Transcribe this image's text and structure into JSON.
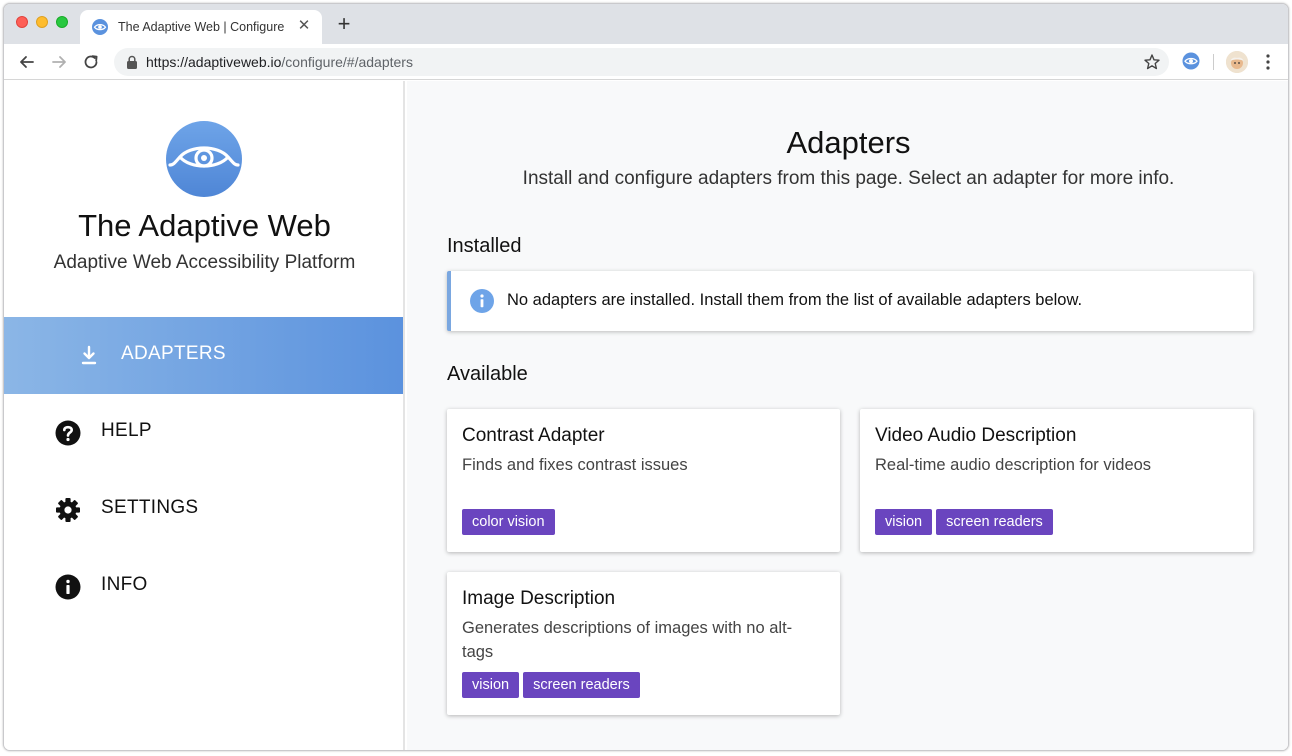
{
  "browser": {
    "tab_title": "The Adaptive Web | Configure",
    "tab_close": "✕",
    "new_tab": "+",
    "url_domain": "https://adaptiveweb.io",
    "url_path": "/configure/#/adapters"
  },
  "sidebar": {
    "brand_title": "The Adaptive Web",
    "brand_subtitle": "Adaptive Web Accessibility Platform",
    "items": [
      {
        "label": "ADAPTERS",
        "icon": "download-icon",
        "active": true
      },
      {
        "label": "HELP",
        "icon": "help-circle-icon",
        "active": false
      },
      {
        "label": "SETTINGS",
        "icon": "gear-icon",
        "active": false
      },
      {
        "label": "INFO",
        "icon": "info-circle-icon",
        "active": false
      }
    ]
  },
  "main": {
    "title": "Adapters",
    "subtitle": "Install and configure adapters from this page. Select an adapter for more info.",
    "installed_heading": "Installed",
    "installed_alert": "No adapters are installed. Install them from the list of available adapters below.",
    "available_heading": "Available",
    "adapters": [
      {
        "name": "Contrast Adapter",
        "description": "Finds and fixes contrast issues",
        "tags": [
          "color vision"
        ]
      },
      {
        "name": "Video Audio Description",
        "description": "Real-time audio description for videos",
        "tags": [
          "vision",
          "screen readers"
        ]
      },
      {
        "name": "Image Description",
        "description": "Generates descriptions of images with no alt-tags",
        "tags": [
          "vision",
          "screen readers"
        ]
      }
    ]
  },
  "colors": {
    "accent": "#5b92de",
    "tag": "#6a45bf",
    "alert_border": "#7aa7e0",
    "logo": "#5b92de"
  }
}
